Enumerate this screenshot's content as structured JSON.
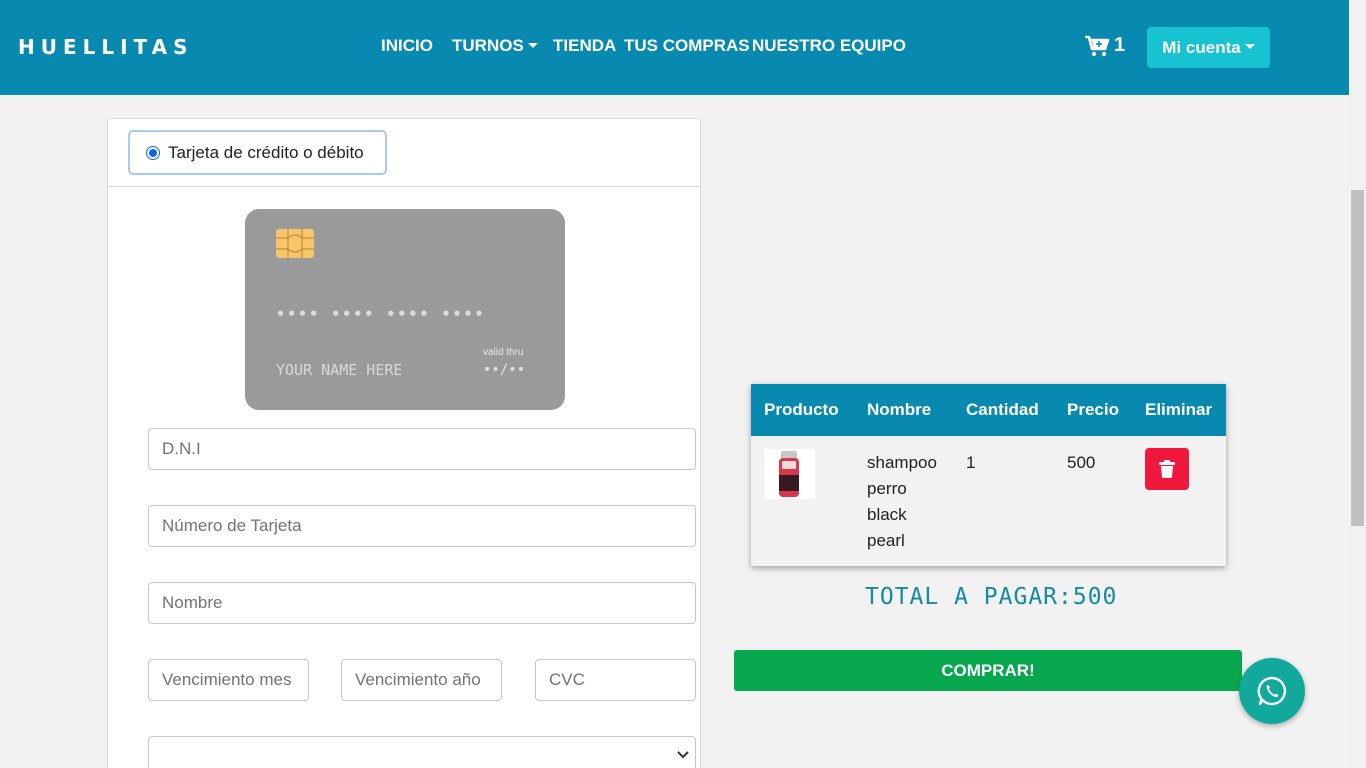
{
  "navbar": {
    "brand": "HUELLITAS",
    "links": [
      "INICIO",
      "TURNOS",
      "TIENDA",
      "TUS COMPRAS",
      "NUESTRO EQUIPO"
    ],
    "cart_count": "1",
    "account_label": "Mi cuenta",
    "bg_color": "#0789b0",
    "account_color": "#17c3d0"
  },
  "payment": {
    "method_label": "Tarjeta de crédito o débito",
    "card": {
      "number": "•••• •••• •••• ••••",
      "name": "YOUR NAME HERE",
      "valid_label": "valid thru",
      "valid_value": "••/••"
    },
    "fields": {
      "dni_placeholder": "D.N.I",
      "card_number_placeholder": "Número de Tarjeta",
      "name_placeholder": "Nombre",
      "exp_month_placeholder": "Vencimiento mes",
      "exp_year_placeholder": "Vencimiento año",
      "cvc_placeholder": "CVC"
    }
  },
  "cart": {
    "headers": [
      "Producto",
      "Nombre",
      "Cantidad",
      "Precio",
      "Eliminar"
    ],
    "rows": [
      {
        "product_icon": "shampoo-bottle-image",
        "name_lines": [
          "shampoo",
          "perro",
          "black",
          "pearl"
        ],
        "quantity": "1",
        "price": "500"
      }
    ],
    "total_label": "TOTAL A PAGAR:500",
    "buy_label": "COMPRAR!",
    "buy_color": "#06a74d",
    "delete_color": "#f0183c"
  },
  "whatsapp": {
    "icon": "whatsapp-icon",
    "color": "#10a99b"
  }
}
